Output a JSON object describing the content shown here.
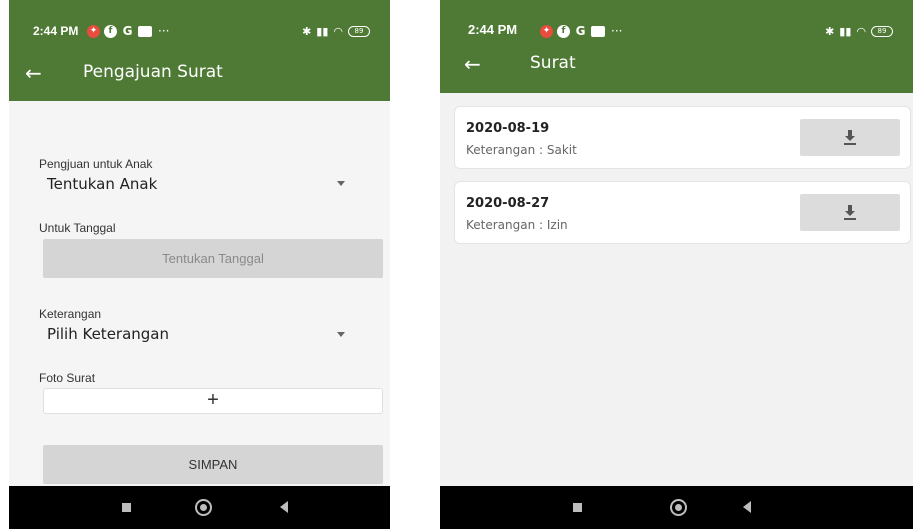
{
  "left": {
    "status": {
      "time": "2:44 PM",
      "battery": "89"
    },
    "title": "Pengajuan Surat",
    "form": {
      "child_label": "Pengjuan untuk Anak",
      "child_value": "Tentukan Anak",
      "date_label": "Untuk Tanggal",
      "date_button": "Tentukan Tanggal",
      "reason_label": "Keterangan",
      "reason_value": "Pilih Keterangan",
      "photo_label": "Foto Surat",
      "photo_add": "+",
      "save_button": "SIMPAN"
    }
  },
  "right": {
    "status": {
      "time": "2:44 PM",
      "battery": "89"
    },
    "title": "Surat",
    "items": [
      {
        "date": "2020-08-19",
        "desc": "Keterangan : Sakit"
      },
      {
        "date": "2020-08-27",
        "desc": "Keterangan : Izin"
      }
    ]
  },
  "colors": {
    "appbar": "#4f7a35",
    "button_grey": "#d5d5d5",
    "navbar": "#000000"
  },
  "icons": [
    "back-arrow-icon",
    "dropdown-arrow-icon",
    "download-icon",
    "home-icon",
    "recents-icon",
    "back-icon"
  ]
}
